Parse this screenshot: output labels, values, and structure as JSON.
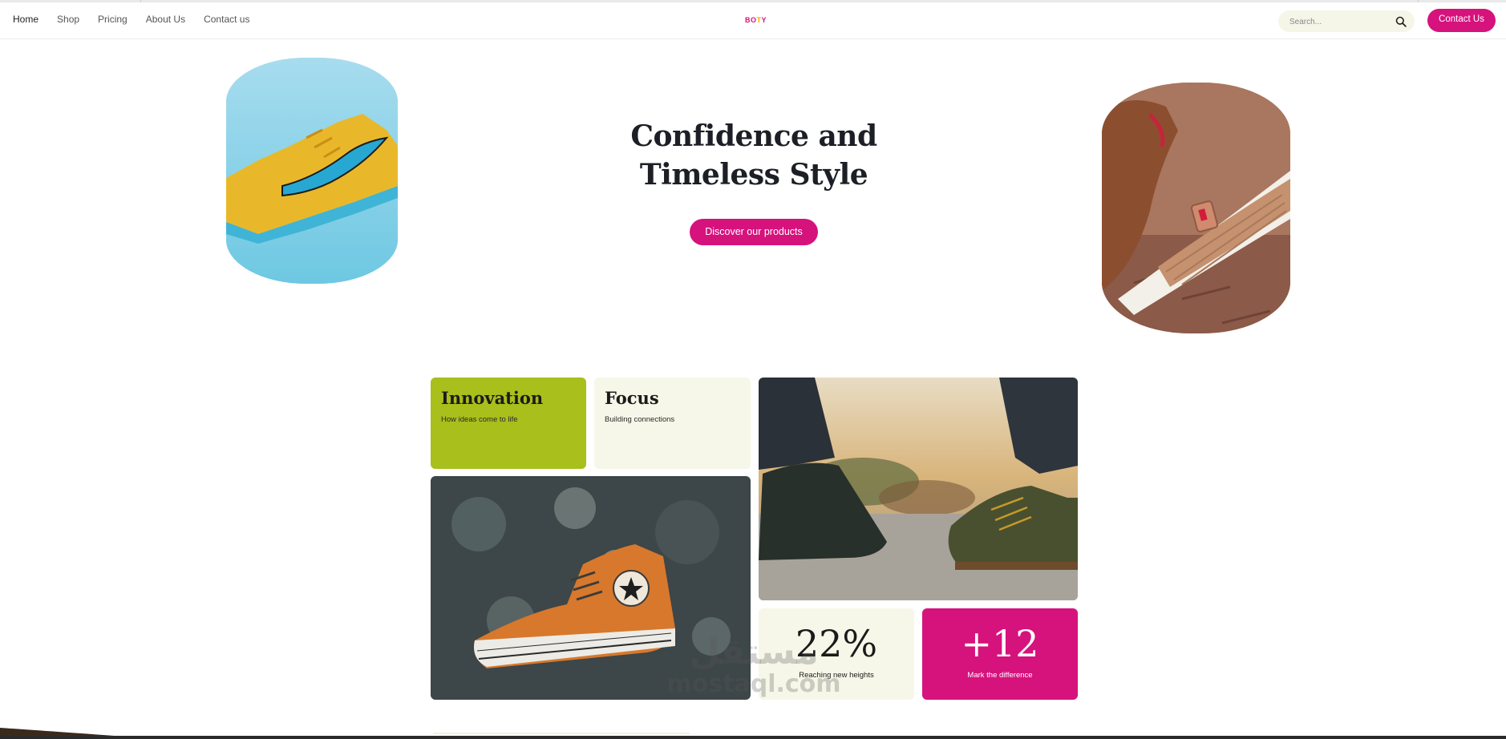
{
  "nav": {
    "links": [
      "Home",
      "Shop",
      "Pricing",
      "About Us",
      "Contact us"
    ],
    "active_index": 0,
    "logo": [
      "BO",
      "T",
      "Y"
    ],
    "search_placeholder": "Search...",
    "contact_button": "Contact Us"
  },
  "hero": {
    "title_line1": "Confidence and",
    "title_line2": "Timeless Style",
    "cta": "Discover our products"
  },
  "grid": {
    "innovation": {
      "title": "Innovation",
      "subtitle": "How ideas come to life"
    },
    "focus": {
      "title": "Focus",
      "subtitle": "Building connections"
    },
    "stat1": {
      "value": "22%",
      "label": "Reaching new heights"
    },
    "stat2": {
      "value": "+12",
      "label": "Mark the difference"
    }
  },
  "watermark": {
    "arabic": "مستقل",
    "latin": "mostaql.com"
  },
  "colors": {
    "accent": "#d6127d",
    "lime": "#a8bf1c",
    "cream": "#f6f7e8",
    "text_dark": "#1c1f25"
  }
}
